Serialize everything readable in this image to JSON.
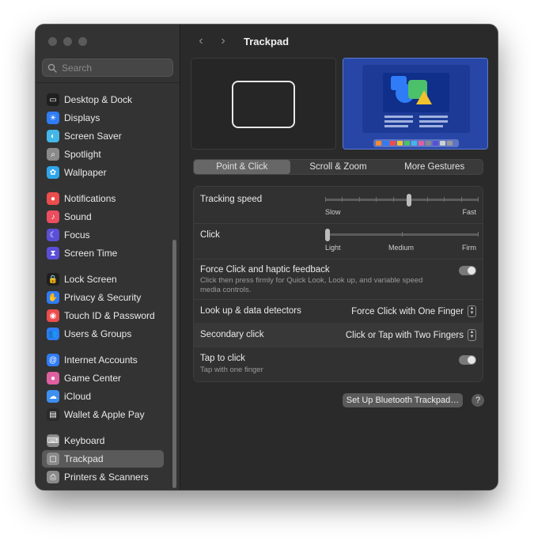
{
  "search": {
    "placeholder": "Search"
  },
  "sidebar": {
    "items": [
      {
        "label": "Desktop & Dock",
        "icon": "dock-icon",
        "color": "#1f1f1f"
      },
      {
        "label": "Displays",
        "icon": "display-icon",
        "color": "#2f7cf6"
      },
      {
        "label": "Screen Saver",
        "icon": "screen-saver-icon",
        "color": "#43b8e8"
      },
      {
        "label": "Spotlight",
        "icon": "spotlight-icon",
        "color": "#8a8a8a"
      },
      {
        "label": "Wallpaper",
        "icon": "wallpaper-icon",
        "color": "#2fa6ea"
      },
      {
        "label": "Notifications",
        "icon": "notifications-icon",
        "color": "#ec4d4d"
      },
      {
        "label": "Sound",
        "icon": "sound-icon",
        "color": "#ec4d5f"
      },
      {
        "label": "Focus",
        "icon": "focus-icon",
        "color": "#5b4fd8"
      },
      {
        "label": "Screen Time",
        "icon": "screen-time-icon",
        "color": "#5b4fd8"
      },
      {
        "label": "Lock Screen",
        "icon": "lock-icon",
        "color": "#1f1f1f"
      },
      {
        "label": "Privacy & Security",
        "icon": "hand-icon",
        "color": "#2f7cf6"
      },
      {
        "label": "Touch ID & Password",
        "icon": "fingerprint-icon",
        "color": "#ec4d4d"
      },
      {
        "label": "Users & Groups",
        "icon": "users-icon",
        "color": "#2f7cf6"
      },
      {
        "label": "Internet Accounts",
        "icon": "at-icon",
        "color": "#2f7cf6"
      },
      {
        "label": "Game Center",
        "icon": "game-center-icon",
        "color": "#e05fa0"
      },
      {
        "label": "iCloud",
        "icon": "cloud-icon",
        "color": "#3d8ff0"
      },
      {
        "label": "Wallet & Apple Pay",
        "icon": "wallet-icon",
        "color": "#2a2a2a"
      },
      {
        "label": "Keyboard",
        "icon": "keyboard-icon",
        "color": "#8a8a8a"
      },
      {
        "label": "Trackpad",
        "icon": "trackpad-icon",
        "color": "#8a8a8a",
        "selected": true
      },
      {
        "label": "Printers & Scanners",
        "icon": "printer-icon",
        "color": "#8a8a8a"
      }
    ]
  },
  "header": {
    "back": "‹",
    "forward": "›",
    "title": "Trackpad"
  },
  "tabs": [
    {
      "label": "Point & Click",
      "selected": true
    },
    {
      "label": "Scroll & Zoom",
      "selected": false
    },
    {
      "label": "More Gestures",
      "selected": false
    }
  ],
  "settings": {
    "tracking": {
      "label": "Tracking speed",
      "min_label": "Slow",
      "max_label": "Fast",
      "value_fraction": 0.55
    },
    "click": {
      "label": "Click",
      "labels": [
        "Light",
        "Medium",
        "Firm"
      ],
      "value_fraction": 0.0
    },
    "force_click": {
      "label": "Force Click and haptic feedback",
      "description_line1": "Click then press firmly for Quick Look, Look up, and variable speed",
      "description_line2": "media controls.",
      "enabled": true
    },
    "lookup": {
      "label": "Look up & data detectors",
      "value": "Force Click with One Finger"
    },
    "secondary": {
      "label": "Secondary click",
      "value": "Click or Tap with Two Fingers"
    },
    "tap": {
      "label": "Tap to click",
      "description": "Tap with one finger",
      "enabled": true
    }
  },
  "footer": {
    "setup_button": "Set Up Bluetooth Trackpad…",
    "help": "?"
  },
  "colors": {
    "accent": "#2f7cf6",
    "window_bg": "#2a2a2a",
    "sidebar_bg": "#333333"
  }
}
